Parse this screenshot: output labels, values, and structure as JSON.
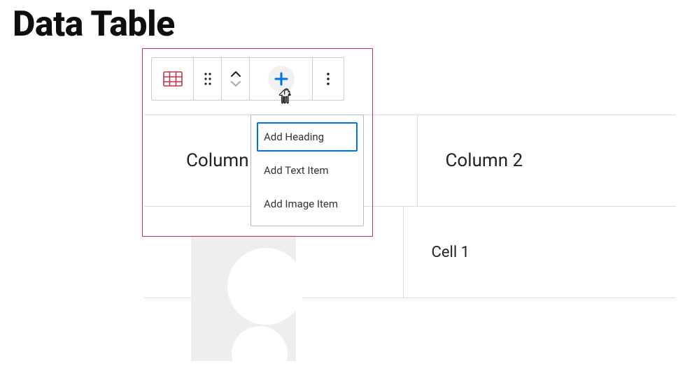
{
  "page": {
    "title": "Data Table"
  },
  "table": {
    "headers": [
      "Column 1",
      "Column 2"
    ],
    "rows": [
      [
        "",
        "Cell 1"
      ]
    ]
  },
  "toolbar": {
    "icons": {
      "table": "table-icon",
      "drag": "drag-icon",
      "up": "chevron-up-icon",
      "down": "chevron-down-icon",
      "add": "plus-icon",
      "more": "more-vertical-icon"
    }
  },
  "dropdown": {
    "items": [
      {
        "label": "Add Heading",
        "selected": true
      },
      {
        "label": "Add Text Item",
        "selected": false
      },
      {
        "label": "Add Image Item",
        "selected": false
      }
    ]
  },
  "colors": {
    "accent": "#0073e6",
    "highlight_border": "#c3334a",
    "table_icon": "#c3334a"
  }
}
